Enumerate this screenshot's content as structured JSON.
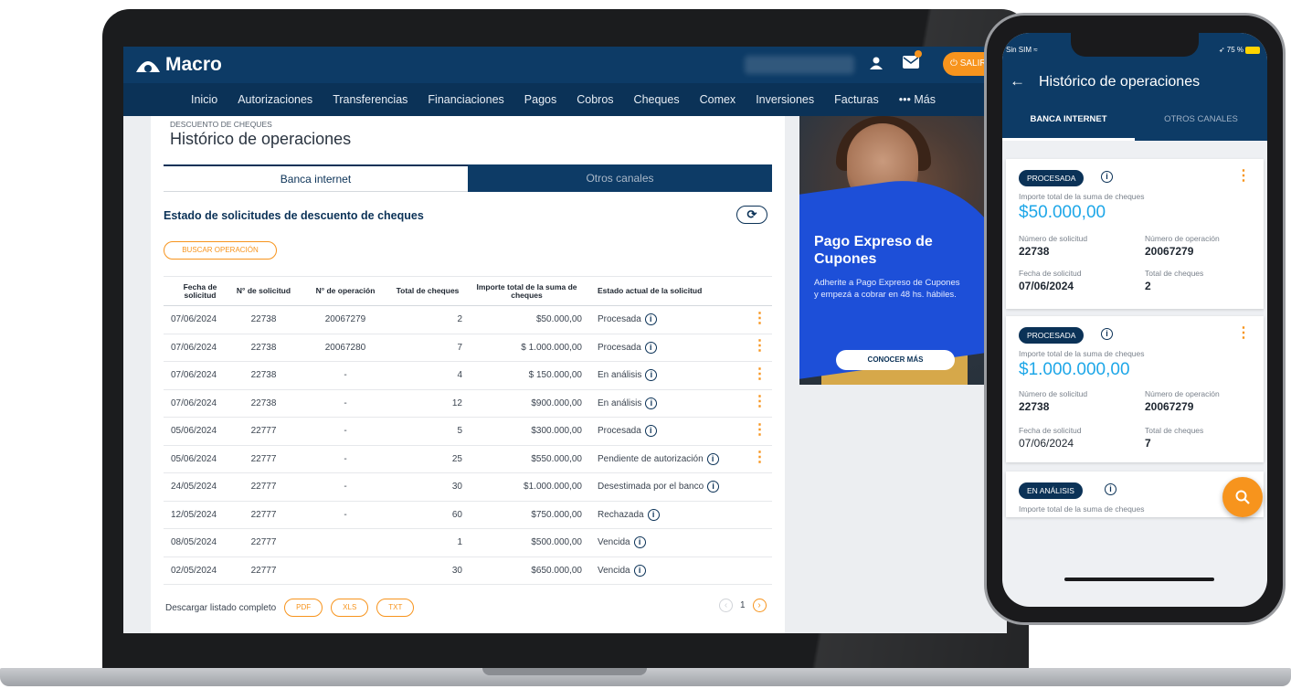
{
  "brand": {
    "name": "Macro",
    "accent": "#f7941d",
    "primary": "#0d3b66",
    "amount_color": "#1ea7e8"
  },
  "header": {
    "exit_label": "SALIR"
  },
  "nav": [
    "Inicio",
    "Autorizaciones",
    "Transferencias",
    "Financiaciones",
    "Pagos",
    "Cobros",
    "Cheques",
    "Comex",
    "Inversiones",
    "Facturas",
    "••• Más"
  ],
  "page": {
    "breadcrumb": "DESCUENTO DE CHEQUES",
    "title": "Histórico de operaciones",
    "tabs": [
      "Banca internet",
      "Otros canales"
    ],
    "section_title": "Estado de solicitudes de descuento de cheques",
    "search_button": "BUSCAR OPERACIÓN"
  },
  "table": {
    "headers": [
      "Fecha de solicitud",
      "N° de solicitud",
      "N° de operación",
      "Total de cheques",
      "Importe total de la suma de cheques",
      "Estado actual de la solicitud"
    ],
    "rows": [
      {
        "fecha": "07/06/2024",
        "sol": "22738",
        "op": "20067279",
        "tot": "2",
        "imp": "$50.000,00",
        "est": "Procesada",
        "menu": true
      },
      {
        "fecha": "07/06/2024",
        "sol": "22738",
        "op": "20067280",
        "tot": "7",
        "imp": "$ 1.000.000,00",
        "est": "Procesada",
        "menu": true
      },
      {
        "fecha": "07/06/2024",
        "sol": "22738",
        "op": "-",
        "tot": "4",
        "imp": "$ 150.000,00",
        "est": "En análisis",
        "menu": true
      },
      {
        "fecha": "07/06/2024",
        "sol": "22738",
        "op": "-",
        "tot": "12",
        "imp": "$900.000,00",
        "est": "En análisis",
        "menu": true
      },
      {
        "fecha": "05/06/2024",
        "sol": "22777",
        "op": "-",
        "tot": "5",
        "imp": "$300.000,00",
        "est": "Procesada",
        "menu": true
      },
      {
        "fecha": "05/06/2024",
        "sol": "22777",
        "op": "-",
        "tot": "25",
        "imp": "$550.000,00",
        "est": "Pendiente de autorización",
        "menu": true
      },
      {
        "fecha": "24/05/2024",
        "sol": "22777",
        "op": "-",
        "tot": "30",
        "imp": "$1.000.000,00",
        "est": "Desestimada por el banco",
        "menu": false
      },
      {
        "fecha": "12/05/2024",
        "sol": "22777",
        "op": "-",
        "tot": "60",
        "imp": "$750.000,00",
        "est": "Rechazada",
        "menu": false
      },
      {
        "fecha": "08/05/2024",
        "sol": "22777",
        "op": "",
        "tot": "1",
        "imp": "$500.000,00",
        "est": "Vencida",
        "menu": false
      },
      {
        "fecha": "02/05/2024",
        "sol": "22777",
        "op": "",
        "tot": "30",
        "imp": "$650.000,00",
        "est": "Vencida",
        "menu": false
      }
    ]
  },
  "download": {
    "label": "Descargar listado completo",
    "formats": [
      "PDF",
      "XLS",
      "TXT"
    ]
  },
  "pagination": {
    "current_page": "1"
  },
  "promo": {
    "title": "Pago Expreso de Cupones",
    "text": "Adherite a Pago Expreso de Cupones y empezá a cobrar en 48 hs. hábiles.",
    "button": "CONOCER MÁS"
  },
  "mobile": {
    "status_left": "Sin SIM",
    "status_right": "75 %",
    "title": "Histórico de operaciones",
    "tabs": [
      "BANCA INTERNET",
      "OTROS CANALES"
    ],
    "labels": {
      "importe": "Importe total de la suma de cheques",
      "num_sol": "Número de solicitud",
      "num_op": "Número de operación",
      "fecha": "Fecha de solicitud",
      "total": "Total de cheques"
    },
    "cards": [
      {
        "estado": "PROCESADA",
        "importe": "$50.000,00",
        "num_sol": "22738",
        "num_op": "20067279",
        "fecha": "07/06/2024",
        "total": "2"
      },
      {
        "estado": "PROCESADA",
        "importe": "$1.000.000,00",
        "num_sol": "22738",
        "num_op": "20067279",
        "fecha": "07/06/2024",
        "total": "7"
      },
      {
        "estado": "EN ANÁLISIS"
      }
    ]
  }
}
